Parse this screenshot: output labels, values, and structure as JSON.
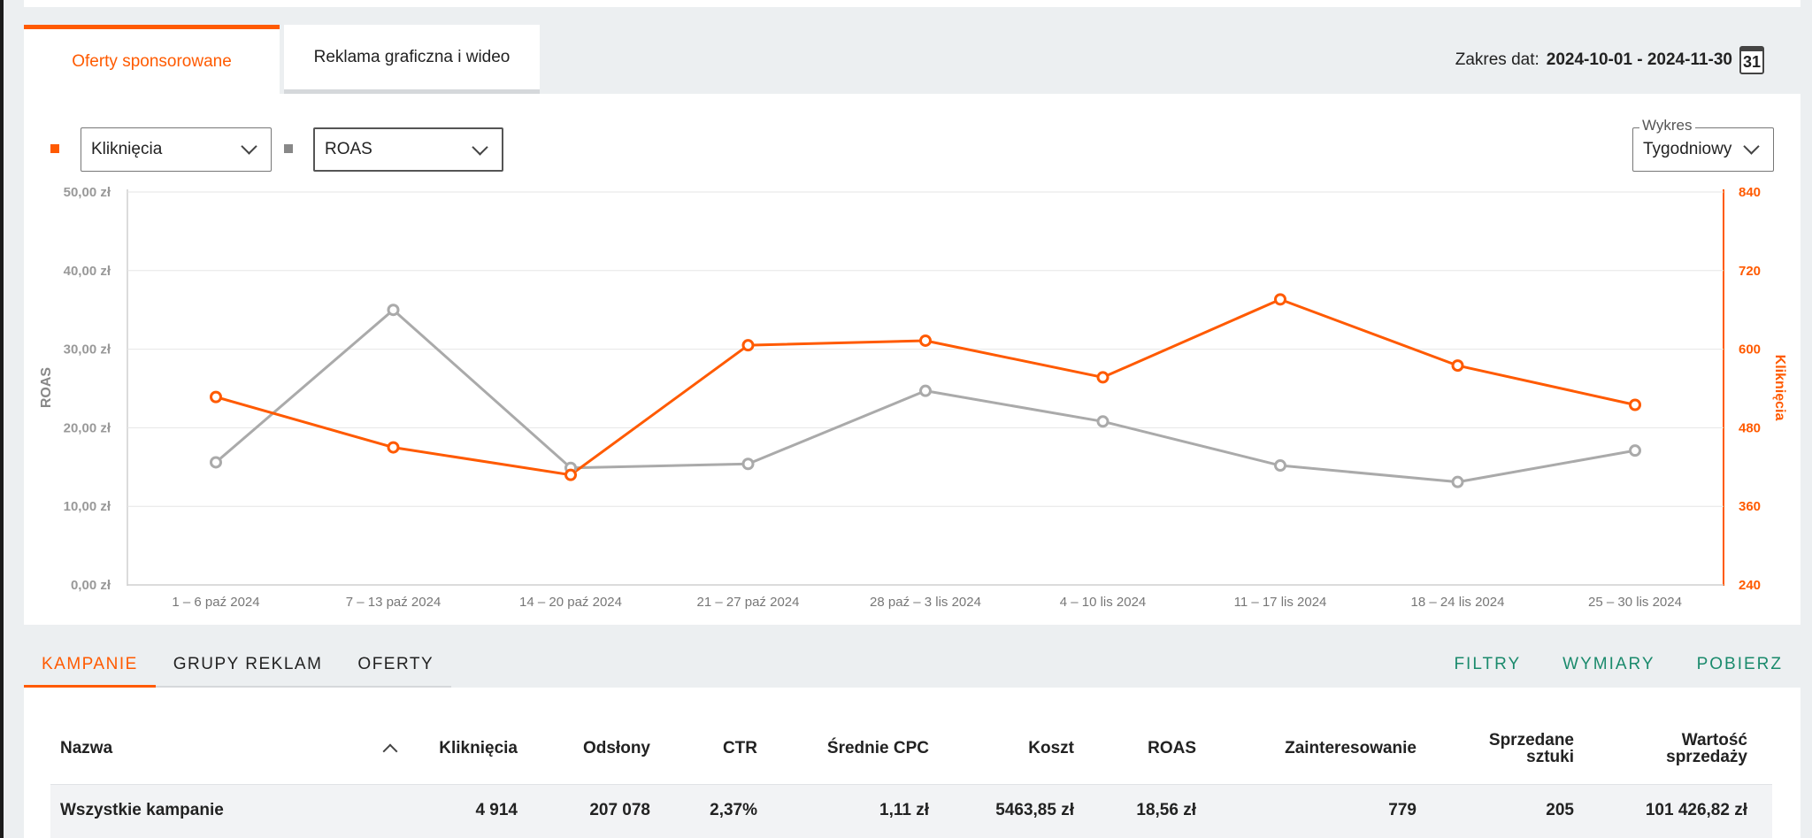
{
  "tabs": [
    {
      "label": "Oferty sponsorowane",
      "active": true
    },
    {
      "label": "Reklama graficzna i wideo",
      "active": false
    }
  ],
  "date_range": {
    "label": "Zakres dat:",
    "value": "2024-10-01 - 2024-11-30",
    "icon": "calendar-icon",
    "icon_text": "31"
  },
  "metric_selectors": [
    {
      "legend_color": "#ff5a00",
      "value": "Kliknięcia"
    },
    {
      "legend_color": "#888888",
      "value": "ROAS"
    }
  ],
  "chart_mode": {
    "label": "Wykres",
    "value": "Tygodniowy"
  },
  "colors": {
    "accent": "#ff5a00",
    "secondary_series": "#aaaaaa",
    "action_link": "#1a8a6c"
  },
  "chart_data": {
    "type": "line",
    "categories": [
      "1 – 6 paź 2024",
      "7 – 13 paź 2024",
      "14 – 20 paź 2024",
      "21 – 27 paź 2024",
      "28 paź – 3 lis 2024",
      "4 – 10 lis 2024",
      "11 – 17 lis 2024",
      "18 – 24 lis 2024",
      "25 – 30 lis 2024"
    ],
    "series": [
      {
        "name": "ROAS",
        "axis": "left",
        "color": "#aaaaaa",
        "values": [
          15.6,
          35.0,
          14.9,
          15.4,
          24.7,
          20.8,
          15.2,
          13.1,
          17.1
        ]
      },
      {
        "name": "Kliknięcia",
        "axis": "right",
        "color": "#ff5a00",
        "values": [
          527,
          450,
          408,
          606,
          613,
          557,
          676,
          575,
          515
        ]
      }
    ],
    "ylabel_left": "ROAS",
    "ylabel_right": "Kliknięcia",
    "ylim_left": [
      0,
      50
    ],
    "ylim_right": [
      240,
      840
    ],
    "left_ticks": [
      "0,00 zł",
      "10,00 zł",
      "20,00 zł",
      "30,00 zł",
      "40,00 zł",
      "50,00 zł"
    ],
    "right_ticks": [
      "240",
      "360",
      "480",
      "600",
      "720",
      "840"
    ],
    "grid": true
  },
  "subtabs": [
    {
      "label": "KAMPANIE",
      "active": true
    },
    {
      "label": "GRUPY REKLAM",
      "active": false
    },
    {
      "label": "OFERTY",
      "active": false
    }
  ],
  "actions": [
    "FILTRY",
    "WYMIARY",
    "POBIERZ"
  ],
  "table": {
    "headers": {
      "nazwa": "Nazwa",
      "klikniecia": "Kliknięcia",
      "odslony": "Odsłony",
      "ctr": "CTR",
      "cpc": "Średnie CPC",
      "koszt": "Koszt",
      "roas": "ROAS",
      "zainteresowanie": "Zainteresowanie",
      "sprzedane_1": "Sprzedane",
      "sprzedane_2": "sztuki",
      "wartosc_1": "Wartość",
      "wartosc_2": "sprzedaży"
    },
    "total_row": {
      "nazwa": "Wszystkie kampanie",
      "klikniecia": "4 914",
      "odslony": "207 078",
      "ctr": "2,37%",
      "cpc": "1,11 zł",
      "koszt": "5463,85 zł",
      "roas": "18,56 zł",
      "zainteresowanie": "779",
      "sprzedane": "205",
      "wartosc": "101 426,82 zł"
    }
  }
}
